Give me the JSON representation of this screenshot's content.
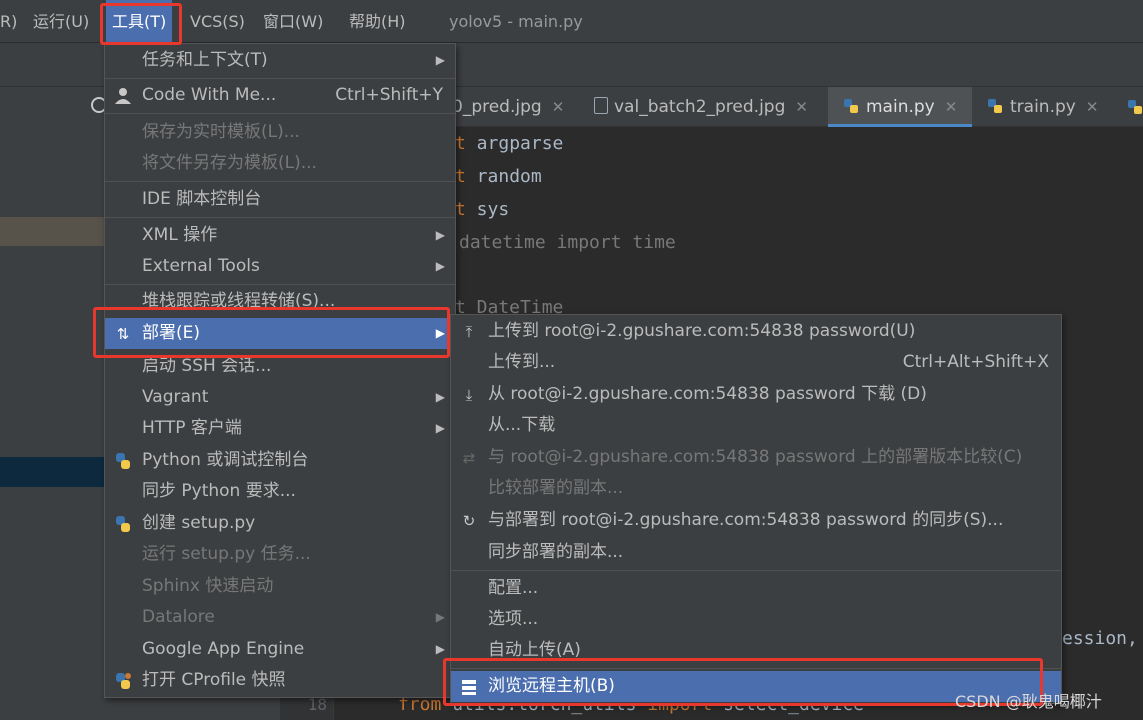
{
  "menubar": {
    "items": [
      "R)",
      "运行(U)",
      "工具(T)",
      "VCS(S)",
      "窗口(W)",
      "帮助(H)"
    ],
    "window_title": "yolov5 - main.py"
  },
  "tabs": [
    {
      "label": "0_pred.jpg",
      "icon": "image-file-icon"
    },
    {
      "label": "val_batch2_pred.jpg",
      "icon": "image-file-icon"
    },
    {
      "label": "main.py",
      "icon": "python-file-icon",
      "active": true
    },
    {
      "label": "train.py",
      "icon": "python-file-icon"
    }
  ],
  "code": {
    "lines": [
      {
        "kw": "t",
        "text": " argparse"
      },
      {
        "kw": "t",
        "text": " random"
      },
      {
        "kw": "t",
        "text": " sys"
      },
      {
        "kw": "",
        "text": "datetime import time",
        "dim": true
      },
      {
        "kw": "",
        "text": "t DateTime",
        "dim": true
      }
    ],
    "right_fragment": "ession,",
    "last_line_number": "18",
    "last_line": {
      "kw1": "from",
      "mid": " utils.torch_utils ",
      "kw2": "import",
      "tail": " select_device"
    }
  },
  "tools_menu": {
    "items": [
      {
        "label": "任务和上下文(T)",
        "submenu": true
      },
      {
        "label": "Code With Me...",
        "shortcut": "Ctrl+Shift+Y",
        "icon": "user-icon"
      },
      {
        "label": "保存为实时模板(L)...",
        "disabled": true
      },
      {
        "label": "将文件另存为模板(L)...",
        "disabled": true
      },
      {
        "label": "IDE 脚本控制台"
      },
      {
        "label": "XML 操作",
        "submenu": true
      },
      {
        "label": "External Tools",
        "submenu": true
      },
      {
        "label": "堆栈跟踪或线程转储(S)..."
      },
      {
        "label": "部署(E)",
        "submenu": true,
        "highlighted": true,
        "icon": "deploy-icon"
      },
      {
        "label": "启动 SSH 会话..."
      },
      {
        "label": "Vagrant",
        "submenu": true
      },
      {
        "label": "HTTP 客户端",
        "submenu": true
      },
      {
        "label": "Python 或调试控制台",
        "icon": "python-icon"
      },
      {
        "label": "同步 Python 要求..."
      },
      {
        "label": "创建 setup.py",
        "icon": "python-file-icon"
      },
      {
        "label": "运行 setup.py 任务...",
        "disabled": true
      },
      {
        "label": "Sphinx 快速启动",
        "disabled": true
      },
      {
        "label": "Datalore",
        "disabled": true,
        "submenu": true
      },
      {
        "label": "Google App Engine",
        "submenu": true
      },
      {
        "label": "打开 CProfile 快照",
        "icon": "cprofile-icon"
      }
    ]
  },
  "deploy_menu": {
    "items": [
      {
        "label": "上传到 root@i-2.gpushare.com:54838 password(U)",
        "icon": "upload-icon"
      },
      {
        "label": "上传到...",
        "shortcut": "Ctrl+Alt+Shift+X"
      },
      {
        "label": "从 root@i-2.gpushare.com:54838 password 下载 (D)",
        "icon": "download-icon"
      },
      {
        "label": "从...下载"
      },
      {
        "label": "与 root@i-2.gpushare.com:54838 password 上的部署版本比较(C)",
        "disabled": true,
        "icon": "compare-icon"
      },
      {
        "label": "比较部署的副本...",
        "disabled": true
      },
      {
        "label": "与部署到 root@i-2.gpushare.com:54838 password 的同步(S)...",
        "icon": "sync-icon"
      },
      {
        "label": "同步部署的副本..."
      },
      {
        "label": "配置..."
      },
      {
        "label": "选项..."
      },
      {
        "label": "自动上传(A)"
      },
      {
        "label": "浏览远程主机(B)",
        "highlighted": true,
        "icon": "remote-host-icon"
      }
    ]
  },
  "watermark": "CSDN @耿鬼喝椰汁",
  "colors": {
    "highlight": "#4b6eaf",
    "annotation_red": "#e8382d",
    "keyword": "#cc7832"
  }
}
